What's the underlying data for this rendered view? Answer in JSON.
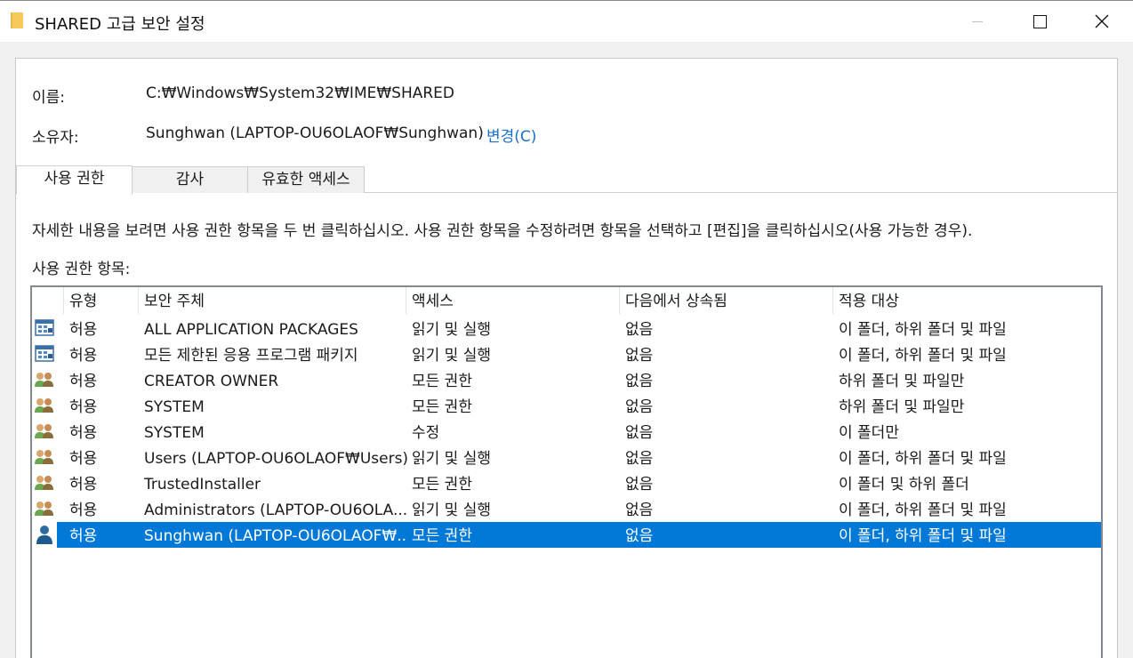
{
  "window": {
    "title": "SHARED 고급 보안 설정",
    "icons": {
      "folder": "folder-icon",
      "minimize": "minimize-icon",
      "maximize": "maximize-icon",
      "close": "close-icon"
    }
  },
  "info": {
    "name_label": "이름:",
    "name_value": "C:₩Windows₩System32₩IME₩SHARED",
    "owner_label": "소유자:",
    "owner_value": "Sunghwan (LAPTOP-OU6OLAOF₩Sunghwan)",
    "change_link": "변경(C)"
  },
  "tabs": [
    {
      "label": "사용 권한",
      "active": true
    },
    {
      "label": "감사",
      "active": false
    },
    {
      "label": "유효한 액세스",
      "active": false
    }
  ],
  "instructions": "자세한 내용을 보려면 사용 권한 항목을 두 번 클릭하십시오. 사용 권한 항목을 수정하려면 항목을 선택하고 [편집]을 클릭하십시오(사용 가능한 경우).",
  "list_label": "사용 권한 항목:",
  "columns": [
    "유형",
    "보안 주체",
    "액세스",
    "다음에서 상속됨",
    "적용 대상"
  ],
  "rows": [
    {
      "icon": "app-package-icon",
      "type": "허용",
      "principal": "ALL APPLICATION PACKAGES",
      "access": "읽기 및 실행",
      "inherited": "없음",
      "applies": "이 폴더, 하위 폴더 및 파일",
      "selected": false
    },
    {
      "icon": "app-package-icon",
      "type": "허용",
      "principal": "모든 제한된 응용 프로그램 패키지",
      "access": "읽기 및 실행",
      "inherited": "없음",
      "applies": "이 폴더, 하위 폴더 및 파일",
      "selected": false
    },
    {
      "icon": "group-icon",
      "type": "허용",
      "principal": "CREATOR OWNER",
      "access": "모든 권한",
      "inherited": "없음",
      "applies": "하위 폴더 및 파일만",
      "selected": false
    },
    {
      "icon": "group-icon",
      "type": "허용",
      "principal": "SYSTEM",
      "access": "모든 권한",
      "inherited": "없음",
      "applies": "하위 폴더 및 파일만",
      "selected": false
    },
    {
      "icon": "group-icon",
      "type": "허용",
      "principal": "SYSTEM",
      "access": "수정",
      "inherited": "없음",
      "applies": "이 폴더만",
      "selected": false
    },
    {
      "icon": "group-icon",
      "type": "허용",
      "principal": "Users (LAPTOP-OU6OLAOF₩Users)",
      "access": "읽기 및 실행",
      "inherited": "없음",
      "applies": "이 폴더, 하위 폴더 및 파일",
      "selected": false
    },
    {
      "icon": "group-icon",
      "type": "허용",
      "principal": "TrustedInstaller",
      "access": "모든 권한",
      "inherited": "없음",
      "applies": "이 폴더 및 하위 폴더",
      "selected": false
    },
    {
      "icon": "group-icon",
      "type": "허용",
      "principal": "Administrators (LAPTOP-OU6OLA...",
      "access": "읽기 및 실행",
      "inherited": "없음",
      "applies": "이 폴더, 하위 폴더 및 파일",
      "selected": false
    },
    {
      "icon": "user-icon",
      "type": "허용",
      "principal": "Sunghwan (LAPTOP-OU6OLAOF₩...",
      "access": "모든 권한",
      "inherited": "없음",
      "applies": "이 폴더, 하위 폴더 및 파일",
      "selected": true
    }
  ],
  "colors": {
    "selection": "#0078d7",
    "link": "#1a6fc9",
    "folder": "#e8b84a"
  }
}
